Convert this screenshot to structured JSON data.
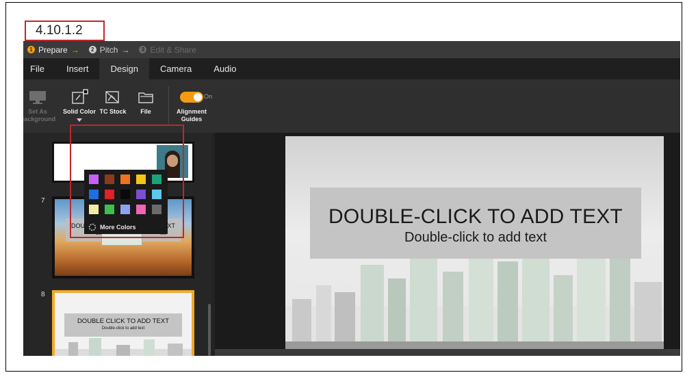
{
  "section": {
    "label": "4.10.1.2"
  },
  "steps": [
    {
      "num": "1",
      "label": "Prepare",
      "arrow": "→"
    },
    {
      "num": "2",
      "label": "Pitch",
      "arrow": "→"
    },
    {
      "num": "3",
      "label": "Edit & Share",
      "arrow": ""
    }
  ],
  "menu": {
    "file": "File",
    "insert": "Insert",
    "design": "Design",
    "camera": "Camera",
    "audio": "Audio"
  },
  "ribbon": {
    "set_background": "Set As Background",
    "solid_color": "Solid Color",
    "tc_stock": "TC Stock",
    "file": "File",
    "alignment_guides": "Alignment Guides",
    "toggle_state": "On"
  },
  "colors": {
    "accent": "#f39c12",
    "highlight": "#c0262c",
    "swatches": [
      "#c661f5",
      "#8b3a1c",
      "#f0731e",
      "#f5c518",
      "#1aa37a",
      "#1f6fe0",
      "#e0202a",
      "#0a0a0a",
      "#7a4fd1",
      "#5cc8f0",
      "#f5eba0",
      "#3fbf4a",
      "#8ea2f5",
      "#f064b4",
      "#6b6b6b"
    ]
  },
  "color_picker": {
    "more_colors": "More Colors"
  },
  "slides": [
    {
      "number": "7",
      "title": "DOUBLE",
      "title_right": "DD TEXT",
      "subtitle": "Do",
      "subtitle_right": "ext"
    },
    {
      "number": "8",
      "title": "DOUBLE CLICK TO ADD TEXT",
      "subtitle": "Double-click to add text"
    }
  ],
  "canvas": {
    "title": "DOUBLE-CLICK TO ADD TEXT",
    "subtitle": "Double-click to add text"
  }
}
